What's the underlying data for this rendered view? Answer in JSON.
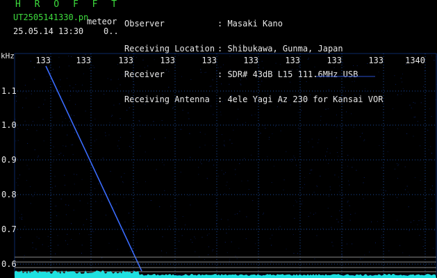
{
  "header": {
    "title": "H R O F F T",
    "filename": "UT2505141330.pn",
    "suffix": "meteor",
    "datetime": "25.05.14 13:30    0..",
    "fields": [
      {
        "label": "Observer",
        "value": ": Masaki Kano"
      },
      {
        "label": "Receiving Location",
        "value": ": Shibukawa, Gunma, Japan"
      },
      {
        "label": "Receiver",
        "value": ": SDR# 43dB L15 111.6MHz USB"
      },
      {
        "label": "Receiving Antenna",
        "value": ": 4ele Yagi Az 230 for Kansai VOR"
      }
    ]
  },
  "axis": {
    "y_unit": "kHz",
    "y_labels": [
      "1.1",
      "1.0",
      "0.9",
      "0.8",
      "0.7",
      "0.6"
    ],
    "x_labels": [
      "133",
      "133",
      "133",
      "133",
      "133",
      "133",
      "133",
      "133",
      "133",
      "1340"
    ]
  },
  "colors": {
    "background": "#000000",
    "grid": "#1a4a9a",
    "trace": "#3a6cff",
    "noise": "#1ee0e0",
    "title": "#3ddc3d",
    "text": "#e8e8e8",
    "hline": "#8a8a8a"
  }
}
